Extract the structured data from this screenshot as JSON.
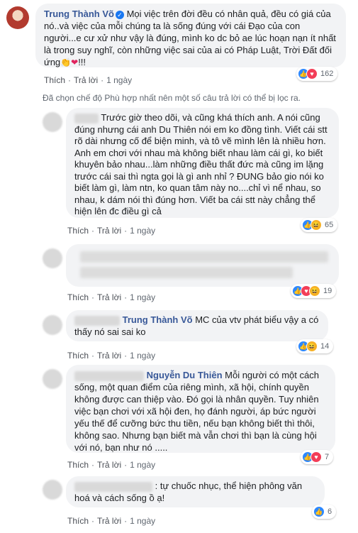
{
  "post": {
    "author": "Trung Thành Võ",
    "text": "Mọi việc trên đời đều có nhân quả, đều có giá của nó..và việc của mỗi chúng ta là sống đúng với cái Đạo của con người...e cư xử như vậy là đúng, mình ko dc bỏ ae lúc hoạn nạn ít nhất là trong suy nghĩ, còn những việc sai của ai có Pháp Luật, Trời Đất đối ứng",
    "emoji_text": "!!!",
    "like": "Thích",
    "reply": "Trả lời",
    "time": "1 ngày",
    "reaction_count": "162"
  },
  "filter_note": "Đã chọn chế độ Phù hợp nhất nên một số câu trả lời có thể bị lọc ra.",
  "comments": [
    {
      "text": "Trước giờ theo dõi, và cũng khá thích anh. A nói cũng đúng nhưng cái anh Du Thiên nói em ko đồng tình. Viết cái stt rõ dài nhưng cố để biện minh, và tô vẽ mình lên là nhiều hơn. Anh em chơi với nhau mà không biết nhau làm cái gì, ko biết khuyên bảo nhau...làm những điều thất đức mà cũng im lặng trước cái sai thì ngta gọi là gì anh nhỉ ? ĐUNG bảo gio nói ko biết làm gì, làm ntn, ko quan tâm này no....chỉ vì nể nhau, so nhau, k dám nói thì đúng hơn. Viết ba cái stt này chẳng thể hiện lên đc điều gì cả",
      "like": "Thích",
      "reply": "Trả lời",
      "time": "1 ngày",
      "reaction_count": "65"
    },
    {
      "like": "Thích",
      "reply": "Trả lời",
      "time": "1 ngày",
      "reaction_count": "19"
    },
    {
      "author": "Trung Thành Võ",
      "text": "MC của vtv phát biểu vậy a có thấy nó sai sai ko",
      "like": "Thích",
      "reply": "Trả lời",
      "time": "1 ngày",
      "reaction_count": "14"
    },
    {
      "author": "Nguyễn Du Thiên",
      "text": "Mỗi người có một cách sống, một quan điểm của riêng mình, xã hội, chính quyền không được can thiệp vào. Đó gọi là nhân quyền. Tuy nhiên việc bạn chơi với xã hội đen, họ đánh người, áp bức người yếu thế để cưỡng bức thu tiền, nếu bạn không biết thì thôi, không sao. Nhưng bạn biết mà vẫn chơi thì bạn là cùng hội với nó, bạn như nó .....",
      "like": "Thích",
      "reply": "Trả lời",
      "time": "1 ngày",
      "reaction_count": "7"
    },
    {
      "text": ": tự chuốc nhục, thể hiện phông văn hoá và cách sống ồ ạ!",
      "like": "Thích",
      "reply": "Trả lời",
      "time": "1 ngày",
      "reaction_count": "6"
    }
  ],
  "colors": {
    "name": "#385898",
    "bubble": "#f2f3f5",
    "like": "#2d88ff",
    "love": "#f33e58",
    "haha": "#f7b125"
  }
}
